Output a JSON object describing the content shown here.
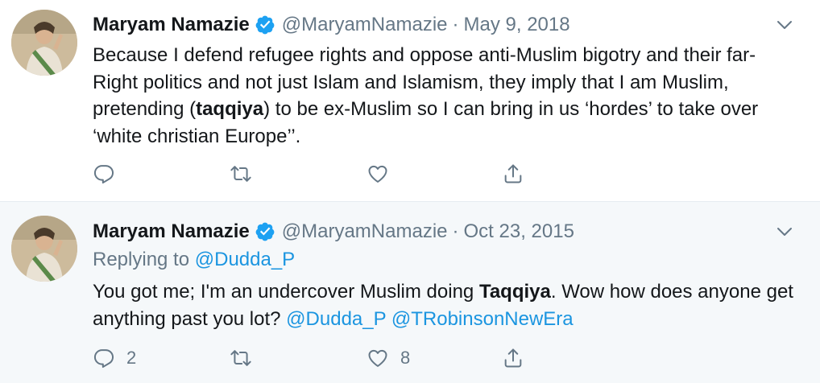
{
  "tweets": [
    {
      "author_name": "Maryam Namazie",
      "handle": "@MaryamNamazie",
      "separator": "·",
      "date": "May 9, 2018",
      "text_parts": [
        "Because I defend refugee rights and oppose anti-Muslim bigotry and their far-Right politics and not just Islam and Islamism, they imply that I am Muslim, pretending (",
        "taqqiya",
        ") to be ex-Muslim so I can bring in us ‘hordes’ to take over ‘white christian Europe’’."
      ],
      "reply_count": "",
      "retweet_count": "",
      "like_count": ""
    },
    {
      "author_name": "Maryam Namazie",
      "handle": "@MaryamNamazie",
      "separator": "·",
      "date": "Oct 23, 2015",
      "replying_label": "Replying to",
      "replying_to": "@Dudda_P",
      "text_parts": [
        "You got me; I'm an undercover Muslim doing ",
        "Taqqiya",
        ". Wow how does anyone get anything past you lot? ",
        "@Dudda_P",
        " ",
        "@TRobinsonNewEra"
      ],
      "reply_count": "2",
      "retweet_count": "",
      "like_count": "8"
    }
  ],
  "icons": {
    "verified": "verified-badge-icon",
    "caret": "chevron-down-icon",
    "reply": "reply-icon",
    "retweet": "retweet-icon",
    "like": "heart-icon",
    "share": "share-icon"
  },
  "colors": {
    "link": "#1b95e0",
    "secondary_text": "#657786",
    "verified": "#1da1f2",
    "highlight_bg": "#f5f8fa"
  }
}
